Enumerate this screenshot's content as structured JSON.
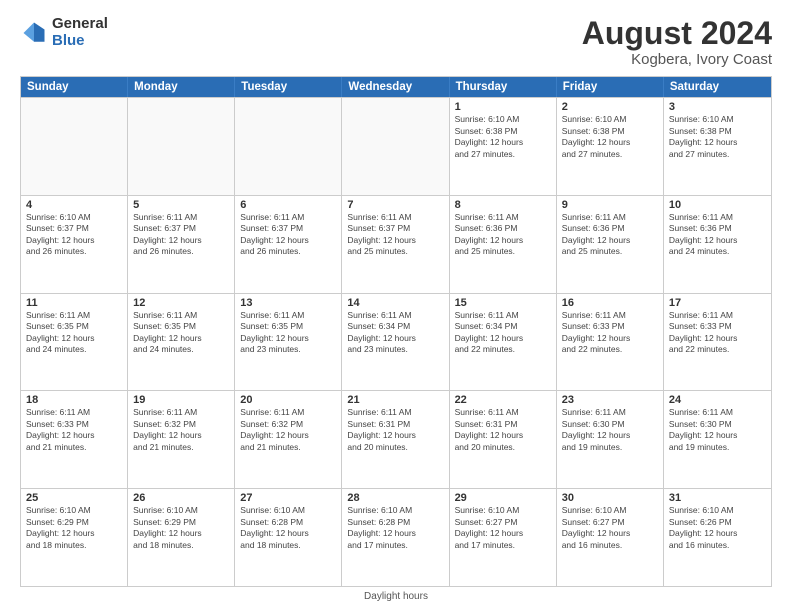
{
  "logo": {
    "general": "General",
    "blue": "Blue"
  },
  "title": {
    "month": "August 2024",
    "location": "Kogbera, Ivory Coast"
  },
  "header_days": [
    "Sunday",
    "Monday",
    "Tuesday",
    "Wednesday",
    "Thursday",
    "Friday",
    "Saturday"
  ],
  "weeks": [
    [
      {
        "day": "",
        "info": "",
        "empty": true
      },
      {
        "day": "",
        "info": "",
        "empty": true
      },
      {
        "day": "",
        "info": "",
        "empty": true
      },
      {
        "day": "",
        "info": "",
        "empty": true
      },
      {
        "day": "1",
        "info": "Sunrise: 6:10 AM\nSunset: 6:38 PM\nDaylight: 12 hours\nand 27 minutes.",
        "empty": false
      },
      {
        "day": "2",
        "info": "Sunrise: 6:10 AM\nSunset: 6:38 PM\nDaylight: 12 hours\nand 27 minutes.",
        "empty": false
      },
      {
        "day": "3",
        "info": "Sunrise: 6:10 AM\nSunset: 6:38 PM\nDaylight: 12 hours\nand 27 minutes.",
        "empty": false
      }
    ],
    [
      {
        "day": "4",
        "info": "Sunrise: 6:10 AM\nSunset: 6:37 PM\nDaylight: 12 hours\nand 26 minutes.",
        "empty": false
      },
      {
        "day": "5",
        "info": "Sunrise: 6:11 AM\nSunset: 6:37 PM\nDaylight: 12 hours\nand 26 minutes.",
        "empty": false
      },
      {
        "day": "6",
        "info": "Sunrise: 6:11 AM\nSunset: 6:37 PM\nDaylight: 12 hours\nand 26 minutes.",
        "empty": false
      },
      {
        "day": "7",
        "info": "Sunrise: 6:11 AM\nSunset: 6:37 PM\nDaylight: 12 hours\nand 25 minutes.",
        "empty": false
      },
      {
        "day": "8",
        "info": "Sunrise: 6:11 AM\nSunset: 6:36 PM\nDaylight: 12 hours\nand 25 minutes.",
        "empty": false
      },
      {
        "day": "9",
        "info": "Sunrise: 6:11 AM\nSunset: 6:36 PM\nDaylight: 12 hours\nand 25 minutes.",
        "empty": false
      },
      {
        "day": "10",
        "info": "Sunrise: 6:11 AM\nSunset: 6:36 PM\nDaylight: 12 hours\nand 24 minutes.",
        "empty": false
      }
    ],
    [
      {
        "day": "11",
        "info": "Sunrise: 6:11 AM\nSunset: 6:35 PM\nDaylight: 12 hours\nand 24 minutes.",
        "empty": false
      },
      {
        "day": "12",
        "info": "Sunrise: 6:11 AM\nSunset: 6:35 PM\nDaylight: 12 hours\nand 24 minutes.",
        "empty": false
      },
      {
        "day": "13",
        "info": "Sunrise: 6:11 AM\nSunset: 6:35 PM\nDaylight: 12 hours\nand 23 minutes.",
        "empty": false
      },
      {
        "day": "14",
        "info": "Sunrise: 6:11 AM\nSunset: 6:34 PM\nDaylight: 12 hours\nand 23 minutes.",
        "empty": false
      },
      {
        "day": "15",
        "info": "Sunrise: 6:11 AM\nSunset: 6:34 PM\nDaylight: 12 hours\nand 22 minutes.",
        "empty": false
      },
      {
        "day": "16",
        "info": "Sunrise: 6:11 AM\nSunset: 6:33 PM\nDaylight: 12 hours\nand 22 minutes.",
        "empty": false
      },
      {
        "day": "17",
        "info": "Sunrise: 6:11 AM\nSunset: 6:33 PM\nDaylight: 12 hours\nand 22 minutes.",
        "empty": false
      }
    ],
    [
      {
        "day": "18",
        "info": "Sunrise: 6:11 AM\nSunset: 6:33 PM\nDaylight: 12 hours\nand 21 minutes.",
        "empty": false
      },
      {
        "day": "19",
        "info": "Sunrise: 6:11 AM\nSunset: 6:32 PM\nDaylight: 12 hours\nand 21 minutes.",
        "empty": false
      },
      {
        "day": "20",
        "info": "Sunrise: 6:11 AM\nSunset: 6:32 PM\nDaylight: 12 hours\nand 21 minutes.",
        "empty": false
      },
      {
        "day": "21",
        "info": "Sunrise: 6:11 AM\nSunset: 6:31 PM\nDaylight: 12 hours\nand 20 minutes.",
        "empty": false
      },
      {
        "day": "22",
        "info": "Sunrise: 6:11 AM\nSunset: 6:31 PM\nDaylight: 12 hours\nand 20 minutes.",
        "empty": false
      },
      {
        "day": "23",
        "info": "Sunrise: 6:11 AM\nSunset: 6:30 PM\nDaylight: 12 hours\nand 19 minutes.",
        "empty": false
      },
      {
        "day": "24",
        "info": "Sunrise: 6:11 AM\nSunset: 6:30 PM\nDaylight: 12 hours\nand 19 minutes.",
        "empty": false
      }
    ],
    [
      {
        "day": "25",
        "info": "Sunrise: 6:10 AM\nSunset: 6:29 PM\nDaylight: 12 hours\nand 18 minutes.",
        "empty": false
      },
      {
        "day": "26",
        "info": "Sunrise: 6:10 AM\nSunset: 6:29 PM\nDaylight: 12 hours\nand 18 minutes.",
        "empty": false
      },
      {
        "day": "27",
        "info": "Sunrise: 6:10 AM\nSunset: 6:28 PM\nDaylight: 12 hours\nand 18 minutes.",
        "empty": false
      },
      {
        "day": "28",
        "info": "Sunrise: 6:10 AM\nSunset: 6:28 PM\nDaylight: 12 hours\nand 17 minutes.",
        "empty": false
      },
      {
        "day": "29",
        "info": "Sunrise: 6:10 AM\nSunset: 6:27 PM\nDaylight: 12 hours\nand 17 minutes.",
        "empty": false
      },
      {
        "day": "30",
        "info": "Sunrise: 6:10 AM\nSunset: 6:27 PM\nDaylight: 12 hours\nand 16 minutes.",
        "empty": false
      },
      {
        "day": "31",
        "info": "Sunrise: 6:10 AM\nSunset: 6:26 PM\nDaylight: 12 hours\nand 16 minutes.",
        "empty": false
      }
    ]
  ],
  "footer": "Daylight hours"
}
